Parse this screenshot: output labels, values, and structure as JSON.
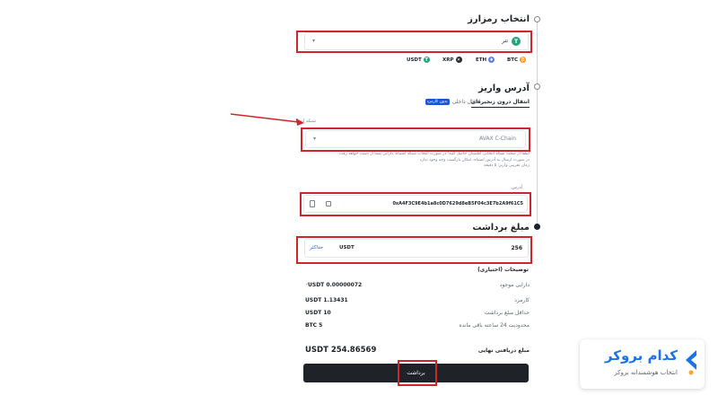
{
  "step1": {
    "title": "انتخاب رمزارز",
    "selected_coin": "USDT",
    "selected_coin_name": "تتر",
    "quick_coins": [
      {
        "label": "USDT",
        "color": "#26a17b"
      },
      {
        "label": "XRP",
        "color": "#23292f"
      },
      {
        "label": "ETH",
        "color": "#627eea"
      },
      {
        "label": "BTC",
        "color": "#f7931a"
      }
    ]
  },
  "step2": {
    "title": "آدرس واریز",
    "tab_onchain": "انتقال درون زنجیره‌ای",
    "tab_internal": "انتقال داخلی",
    "tab_badge": "بدون کارمزد",
    "network_label": "شبکه انتقال",
    "network_value": "AVAX C-Chain",
    "network_note_line1": "لطفاً از صحت شبکه انتخابی اطمینان حاصل کنید؛ در صورت انتخاب شبکه اشتباه، دارایی شما از دست خواهد رفت.",
    "network_note_line2": "در صورت ارسال به آدرس اشتباه، امکان بازگشت وجه وجود ندارد.",
    "network_note_line3": "زمان تقریبی واریز: ۵ دقیقه",
    "address_label": "آدرس",
    "address_value": "0xA4F3C9E4b1a8c0D7629d8eB5F04c3E7b2A9f61C5"
  },
  "step3": {
    "title": "مبلغ برداشت",
    "max_label": "حداکثر",
    "currency": "USDT",
    "amount": "256",
    "notes_label": "توضیحات (اختیاری)",
    "rows": [
      {
        "label": "دارایی موجود",
        "value": "USDT 0.00000072"
      },
      {
        "label": "کارمزد",
        "value": "USDT 1.13431"
      },
      {
        "label": "حداقل مبلغ برداشت",
        "value": "USDT 10"
      },
      {
        "label": "محدودیت 24 ساعته باقی مانده",
        "value": "BTC 5"
      }
    ],
    "final_label": "مبلغ دریافتی نهایی",
    "final_value": "USDT 254.86569",
    "confirm_label": "برداشت"
  },
  "watermark": {
    "name": "کدام بروکر",
    "tagline": "انتخاب هوشمندانه بروکر",
    "accent": "#1a73e8",
    "accent2": "#f5a623"
  },
  "colors": {
    "highlight": "#d0262b",
    "arrow": "#d0262b",
    "tab_badge_bg": "#1a56db"
  }
}
